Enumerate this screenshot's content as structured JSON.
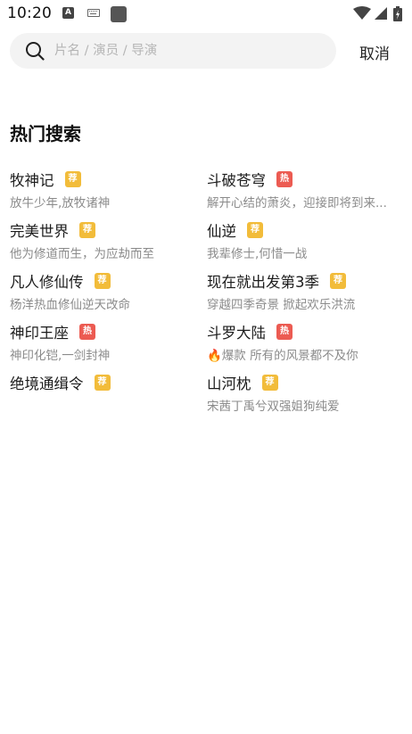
{
  "status_bar": {
    "time": "10:20",
    "icons": [
      "text-a-icon",
      "keyboard-icon",
      "app-square-icon",
      "wifi-icon",
      "signal-icon",
      "battery-icon"
    ]
  },
  "search": {
    "placeholder": "片名 / 演员 / 导演",
    "value": "",
    "cancel_label": "取消"
  },
  "section": {
    "title": "热门搜索"
  },
  "badge_colors": {
    "荐": "#f2bc3a",
    "热": "#ec5b52"
  },
  "hot_items": [
    {
      "title": "牧神记",
      "badge": "荐",
      "desc": "放牛少年,放牧诸神"
    },
    {
      "title": "斗破苍穹",
      "badge": "热",
      "desc": "解开心结的萧炎，迎接即将到来..."
    },
    {
      "title": "完美世界",
      "badge": "荐",
      "desc": "他为修道而生，为应劫而至"
    },
    {
      "title": "仙逆",
      "badge": "荐",
      "desc": "我辈修士,何惜一战"
    },
    {
      "title": "凡人修仙传",
      "badge": "荐",
      "desc": "杨洋热血修仙逆天改命"
    },
    {
      "title": "现在就出发第3季",
      "badge": "荐",
      "desc": "穿越四季奇景 掀起欢乐洪流"
    },
    {
      "title": "神印王座",
      "badge": "热",
      "desc": "神印化铠,一剑封神"
    },
    {
      "title": "斗罗大陆",
      "badge": "热",
      "desc": "🔥爆款 所有的风景都不及你"
    },
    {
      "title": "绝境通缉令",
      "badge": "荐",
      "desc": ""
    },
    {
      "title": "山河枕",
      "badge": "荐",
      "desc": "宋茜丁禹兮双强姐狗纯爱"
    }
  ]
}
